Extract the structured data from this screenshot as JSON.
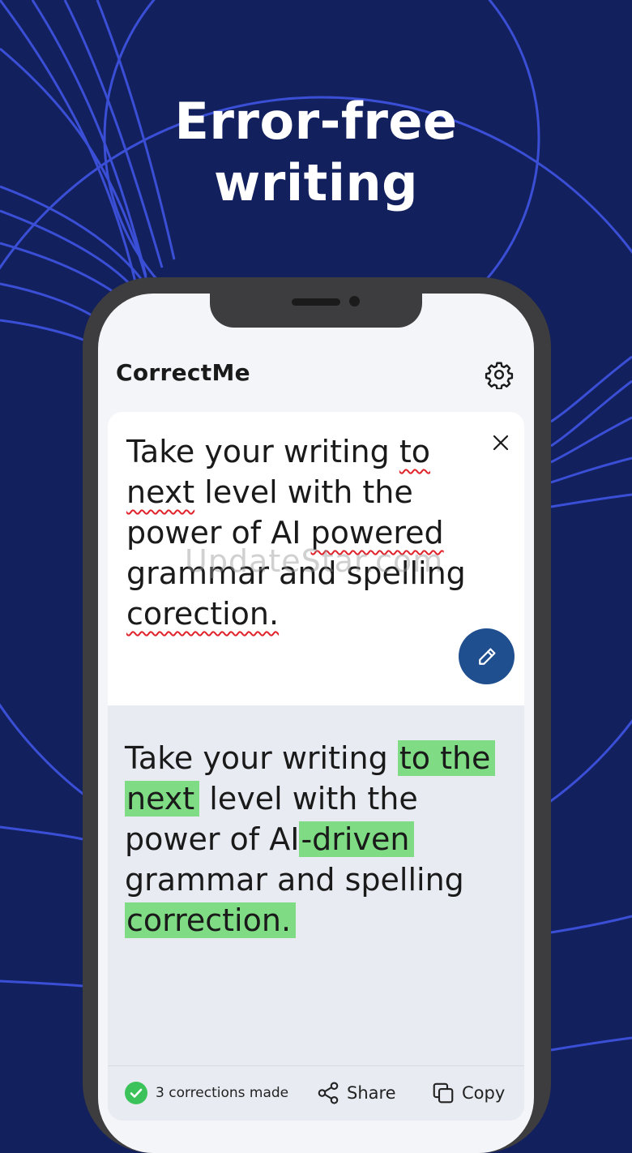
{
  "headline": {
    "line1": "Error-free",
    "line2": "writing"
  },
  "app": {
    "title": "CorrectMe",
    "settings_icon": "gear-icon"
  },
  "input": {
    "segments": [
      {
        "text": "Take your writing ",
        "error": false
      },
      {
        "text": "to",
        "error": true
      },
      {
        "text": " ",
        "error": false
      },
      {
        "text": "next",
        "error": true
      },
      {
        "text": " level with the power of AI ",
        "error": false
      },
      {
        "text": "powered",
        "error": true
      },
      {
        "text": " grammar and spelling ",
        "error": false
      },
      {
        "text": "corection.",
        "error": true
      }
    ],
    "clear_icon": "close-icon",
    "edit_icon": "pencil-icon"
  },
  "output": {
    "segments": [
      {
        "text": "Take your writing ",
        "fixed": false
      },
      {
        "text": "to the",
        "fixed": true
      },
      {
        "text": " ",
        "fixed": false
      },
      {
        "text": "next",
        "fixed": true
      },
      {
        "text": " level with the power of AI",
        "fixed": false
      },
      {
        "text": "-driven",
        "fixed": true
      },
      {
        "text": " grammar and spelling ",
        "fixed": false
      },
      {
        "text": "correction.",
        "fixed": true
      }
    ]
  },
  "footer": {
    "status": "3 corrections made",
    "share_label": "Share",
    "copy_label": "Copy"
  },
  "watermark": "UpdateStar.com",
  "colors": {
    "background": "#13205e",
    "accent_lines": "#3a4fd6",
    "fab": "#1f4f8f",
    "highlight": "#7fdc84",
    "error_underline": "#e0232b",
    "check": "#3cc25a"
  }
}
